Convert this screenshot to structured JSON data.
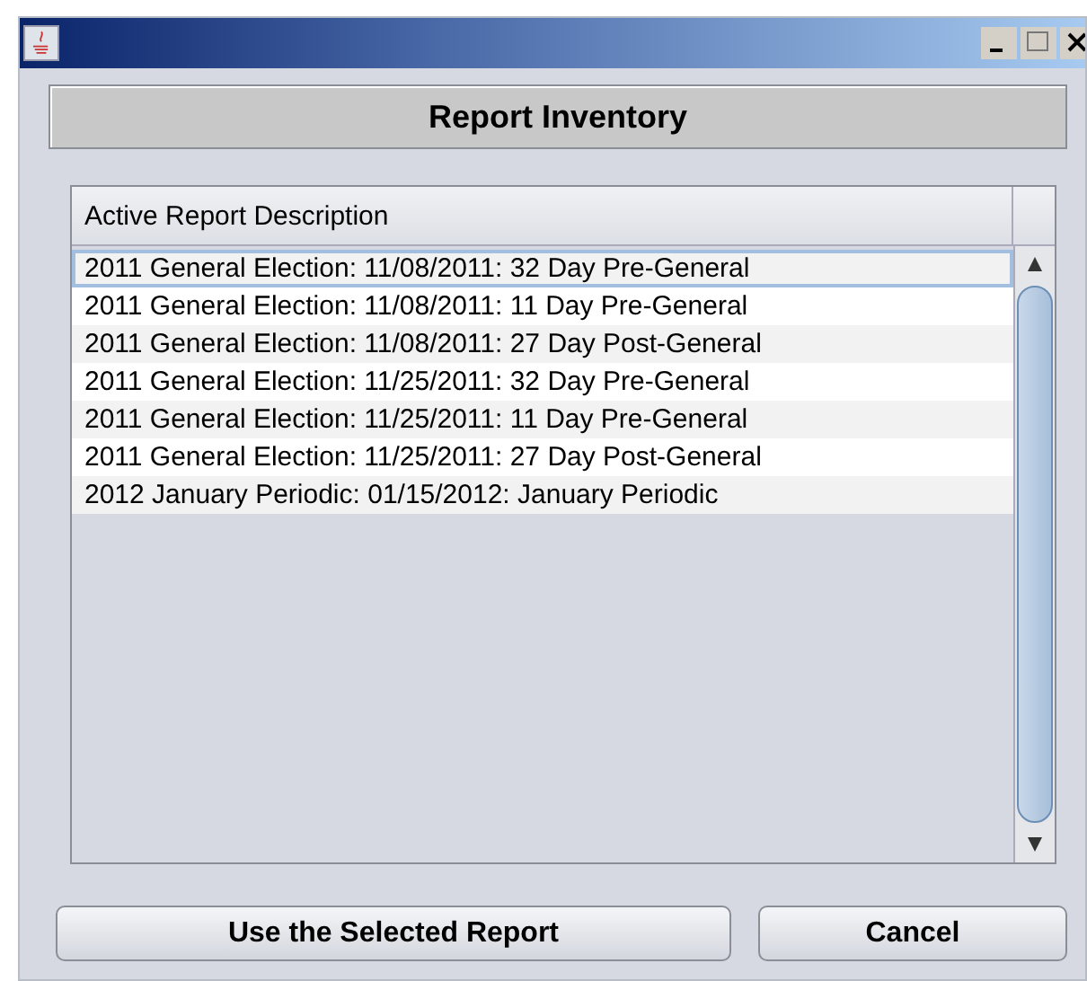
{
  "window": {
    "title": "Report Inventory"
  },
  "table": {
    "columns": [
      "Active Report Description"
    ],
    "rows": [
      {
        "text": "2011 General Election: 11/08/2011: 32 Day Pre-General",
        "selected": true
      },
      {
        "text": "2011 General Election: 11/08/2011: 11 Day Pre-General",
        "selected": false
      },
      {
        "text": "2011 General Election: 11/08/2011: 27 Day Post-General",
        "selected": false
      },
      {
        "text": "2011 General Election: 11/25/2011: 32 Day Pre-General",
        "selected": false
      },
      {
        "text": "2011 General Election: 11/25/2011: 11 Day Pre-General",
        "selected": false
      },
      {
        "text": "2011 General Election: 11/25/2011: 27 Day Post-General",
        "selected": false
      },
      {
        "text": "2012 January Periodic: 01/15/2012: January Periodic",
        "selected": false
      }
    ]
  },
  "buttons": [
    "Use the Selected Report",
    "Cancel"
  ]
}
